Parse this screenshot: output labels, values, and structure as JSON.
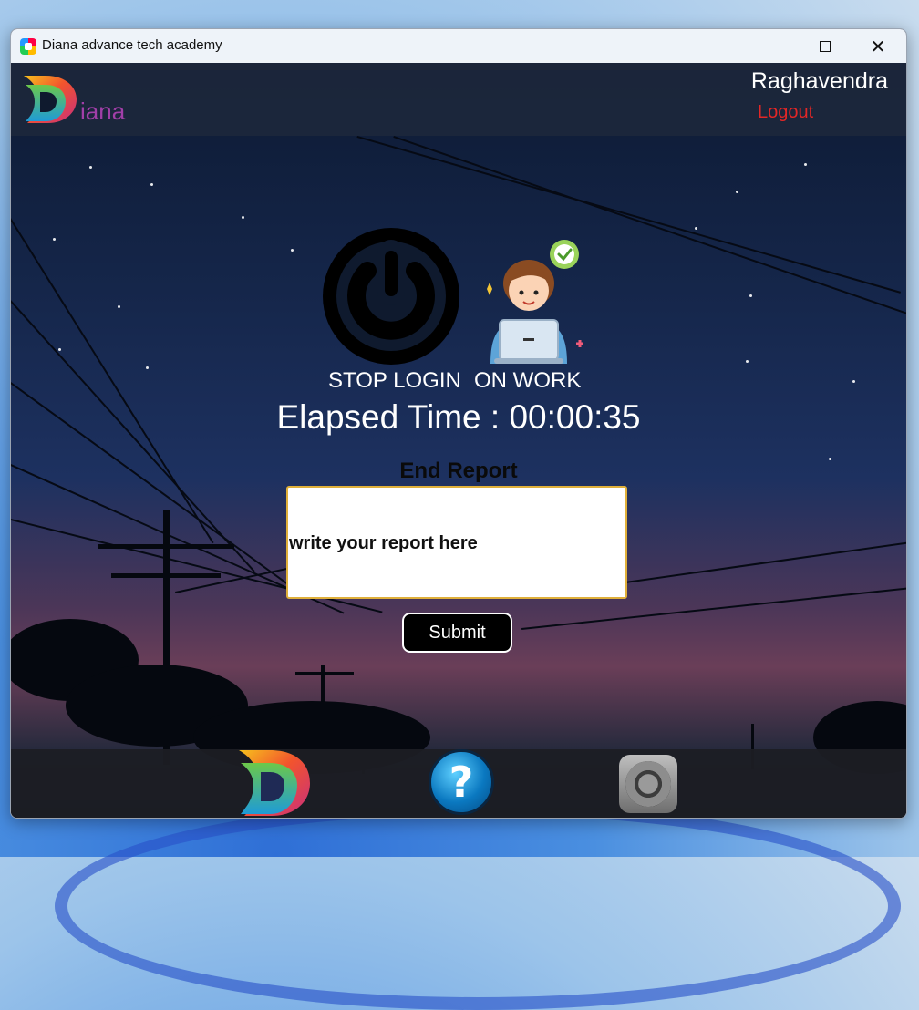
{
  "window": {
    "title": "Diana advance tech academy",
    "controls": {
      "minimize": "minimize",
      "maximize": "maximize",
      "close": "close"
    }
  },
  "header": {
    "logo_text": "iana",
    "user_name": "Raghavendra",
    "logout_label": "Logout"
  },
  "status": {
    "stop_login_label": "STOP LOGIN",
    "on_work_label": "ON WORK",
    "elapsed_label": "Elapsed Time : 00:00:35"
  },
  "report": {
    "heading": "End Report",
    "value": "write your report here",
    "submit_label": "Submit"
  },
  "footer": {
    "items": [
      {
        "icon": "diana-logo-icon"
      },
      {
        "icon": "help-icon",
        "glyph": "?"
      },
      {
        "icon": "settings-icon"
      }
    ]
  },
  "colors": {
    "logout": "#e32626",
    "logo_text": "#a13fa8",
    "report_border": "#e0b03a"
  }
}
